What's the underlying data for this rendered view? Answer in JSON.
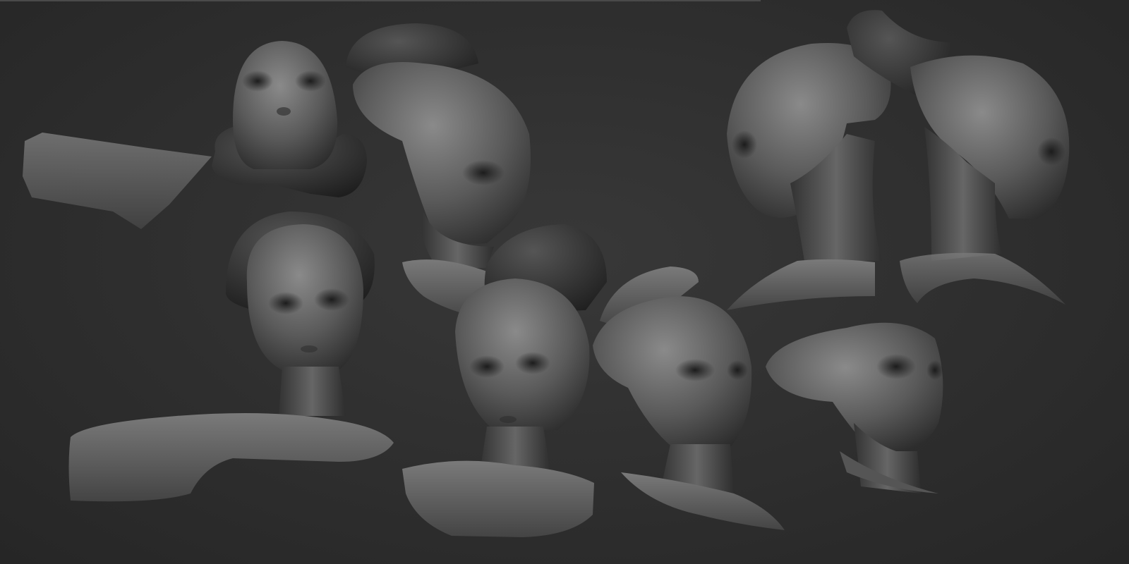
{
  "scene": {
    "background": "#2d2d2d",
    "material": "grey clay",
    "sculpt_count": 8,
    "sculpts": [
      {
        "name": "alien-bust-low-angle",
        "view": "below"
      },
      {
        "name": "alien-bust-three-quarter-top",
        "view": "three-quarter"
      },
      {
        "name": "alien-bust-front",
        "view": "front"
      },
      {
        "name": "alien-bust-front-tilted",
        "view": "front"
      },
      {
        "name": "alien-bust-right-three-quarter",
        "view": "three-quarter"
      },
      {
        "name": "alien-bust-profile-left",
        "view": "side"
      },
      {
        "name": "alien-bust-profile-right",
        "view": "side"
      },
      {
        "name": "alien-bust-small-three-quarter",
        "view": "three-quarter"
      }
    ]
  }
}
